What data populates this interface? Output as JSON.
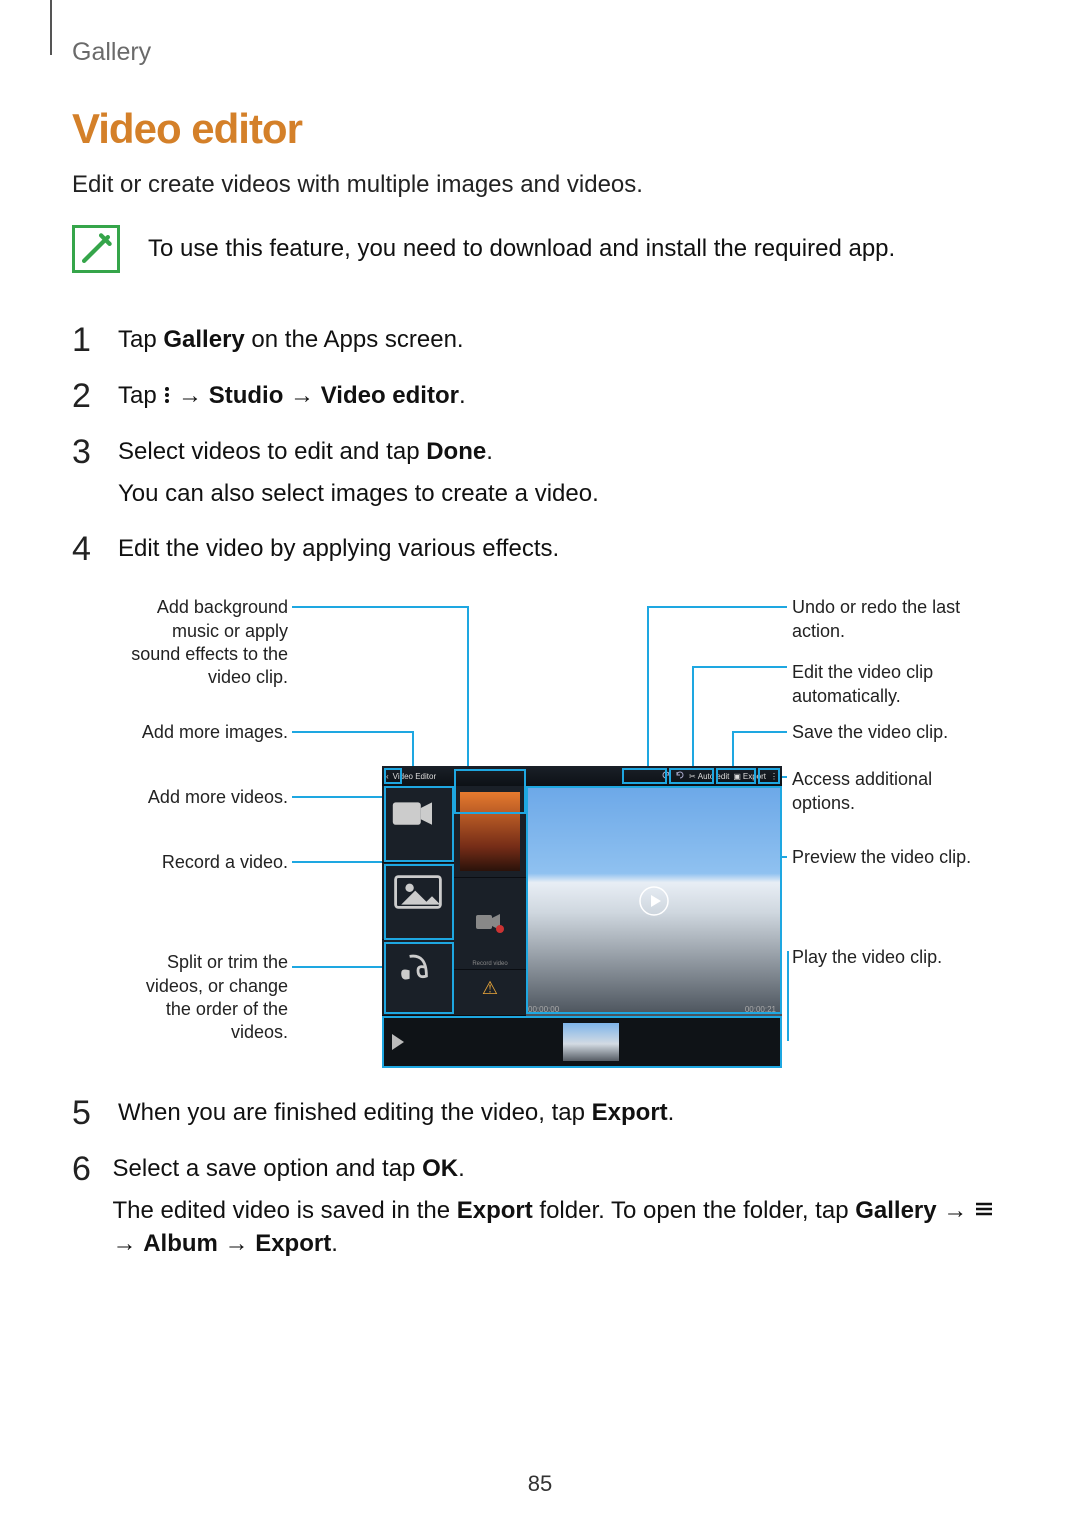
{
  "breadcrumb": "Gallery",
  "title": "Video editor",
  "intro": "Edit or create videos with multiple images and videos.",
  "callout": "To use this feature, you need to download and install the required app.",
  "steps": {
    "s1_a": "Tap ",
    "s1_b": "Gallery",
    "s1_c": " on the Apps screen.",
    "s2_a": "Tap ",
    "s2_b": " → ",
    "s2_c": "Studio",
    "s2_d": " → ",
    "s2_e": "Video editor",
    "s2_f": ".",
    "s3_a": "Select videos to edit and tap ",
    "s3_b": "Done",
    "s3_c": ".",
    "s3_sub": "You can also select images to create a video.",
    "s4": "Edit the video by applying various effects.",
    "s5_a": "When you are finished editing the video, tap ",
    "s5_b": "Export",
    "s5_c": ".",
    "s6_a": "Select a save option and tap ",
    "s6_b": "OK",
    "s6_c": ".",
    "s6_sub_a": "The edited video is saved in the ",
    "s6_sub_b": "Export",
    "s6_sub_c": " folder. To open the folder, tap ",
    "s6_sub_d": "Gallery",
    "s6_sub_e": " → ",
    "s6_sub_f": " → ",
    "s6_sub_g": "Album",
    "s6_sub_h": " → ",
    "s6_sub_i": "Export",
    "s6_sub_j": "."
  },
  "step_numbers": {
    "n1": "1",
    "n2": "2",
    "n3": "3",
    "n4": "4",
    "n5": "5",
    "n6": "6"
  },
  "figure": {
    "left": {
      "sound": "Add background music or apply sound effects to the video clip.",
      "images": "Add more images.",
      "videos": "Add more videos.",
      "record": "Record a video.",
      "split": "Split or trim the videos, or change the order of the videos."
    },
    "right": {
      "undo": "Undo or redo the last action.",
      "autoedit": "Edit the video clip automatically.",
      "save": "Save the video clip.",
      "options": "Access additional options.",
      "preview": "Preview the video clip.",
      "play": "Play the video clip."
    },
    "device": {
      "back": "‹",
      "title": "Video Editor",
      "autoedit": "Auto edit",
      "export": "Export",
      "time_left": "00:00:00",
      "time_right": "00:00:21"
    }
  },
  "page_number": "85"
}
